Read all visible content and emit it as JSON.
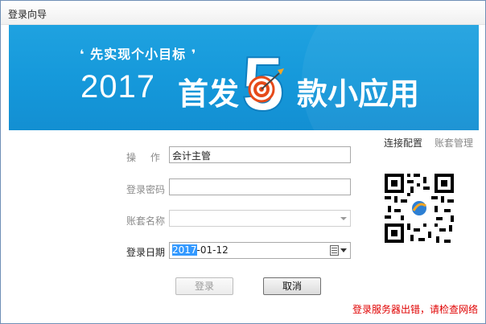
{
  "window": {
    "title": "登录向导"
  },
  "banner": {
    "slogan": "❛ 先实现个小目标 ❜",
    "year": "2017",
    "headline_left": "首发",
    "badge_number": "5",
    "headline_right": "款小应用",
    "colors": {
      "background": "#1598da",
      "badge": "#ffffff",
      "target_red": "#e64a19",
      "arrow_orange": "#f5a623"
    }
  },
  "links": {
    "connect_config": "连接配置",
    "account_manage": "账套管理"
  },
  "form": {
    "operator": {
      "label": "操 作 员",
      "value": "会计主管"
    },
    "password": {
      "label": "登录密码",
      "value": ""
    },
    "account_book": {
      "label": "账套名称",
      "value": ""
    },
    "login_date": {
      "label": "登录日期",
      "value_selected": "2017",
      "value_rest": "-01-12"
    }
  },
  "buttons": {
    "login": "登录",
    "cancel": "取消"
  },
  "status": {
    "message": "登录服务器出错，请检查网络",
    "color": "#e00000"
  }
}
